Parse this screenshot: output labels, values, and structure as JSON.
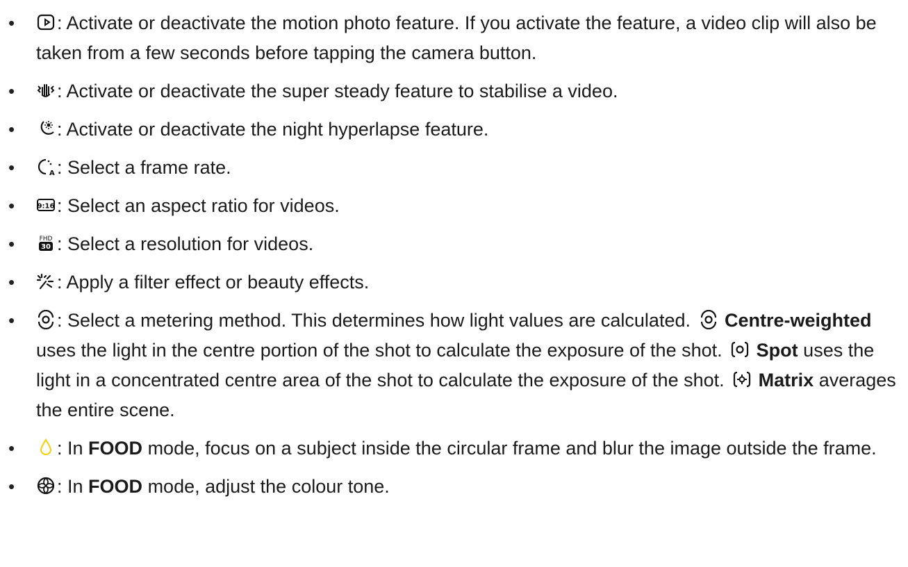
{
  "items": [
    {
      "icon": "motion-photo-icon",
      "text": ": Activate or deactivate the motion photo feature. If you activate the feature, a video clip will also be taken from a few seconds before tapping the camera button."
    },
    {
      "icon": "super-steady-icon",
      "text": ": Activate or deactivate the super steady feature to stabilise a video."
    },
    {
      "icon": "night-hyperlapse-icon",
      "text": ": Activate or deactivate the night hyperlapse feature."
    },
    {
      "icon": "frame-rate-icon",
      "text": ": Select a frame rate."
    },
    {
      "icon": "aspect-ratio-icon",
      "icon_label": "9:16",
      "text": ": Select an aspect ratio for videos."
    },
    {
      "icon": "resolution-icon",
      "icon_label_top": "FHD",
      "icon_label_bottom": "30",
      "text": ": Select a resolution for videos."
    },
    {
      "icon": "filter-effect-icon",
      "text": ": Apply a filter effect or beauty effects."
    },
    {
      "icon": "metering-icon",
      "part1": ": Select a metering method. This determines how light values are calculated.",
      "centre_label": "Centre-weighted",
      "centre_text": "uses the light in the centre portion of the shot to calculate the exposure of the shot.",
      "spot_label": "Spot",
      "spot_text": "uses the light in a concentrated centre area of the shot to calculate the exposure of the shot.",
      "matrix_label": "Matrix",
      "matrix_text": "averages the entire scene."
    },
    {
      "icon": "food-focus-icon",
      "prefix": ": In",
      "mode": "FOOD",
      "text": "mode, focus on a subject inside the circular frame and blur the image outside the frame."
    },
    {
      "icon": "colour-tone-icon",
      "prefix": ": In",
      "mode": "FOOD",
      "text": "mode, adjust the colour tone."
    }
  ],
  "colors": {
    "text": "#1a1a1a",
    "food_icon": "#f2d21b"
  }
}
